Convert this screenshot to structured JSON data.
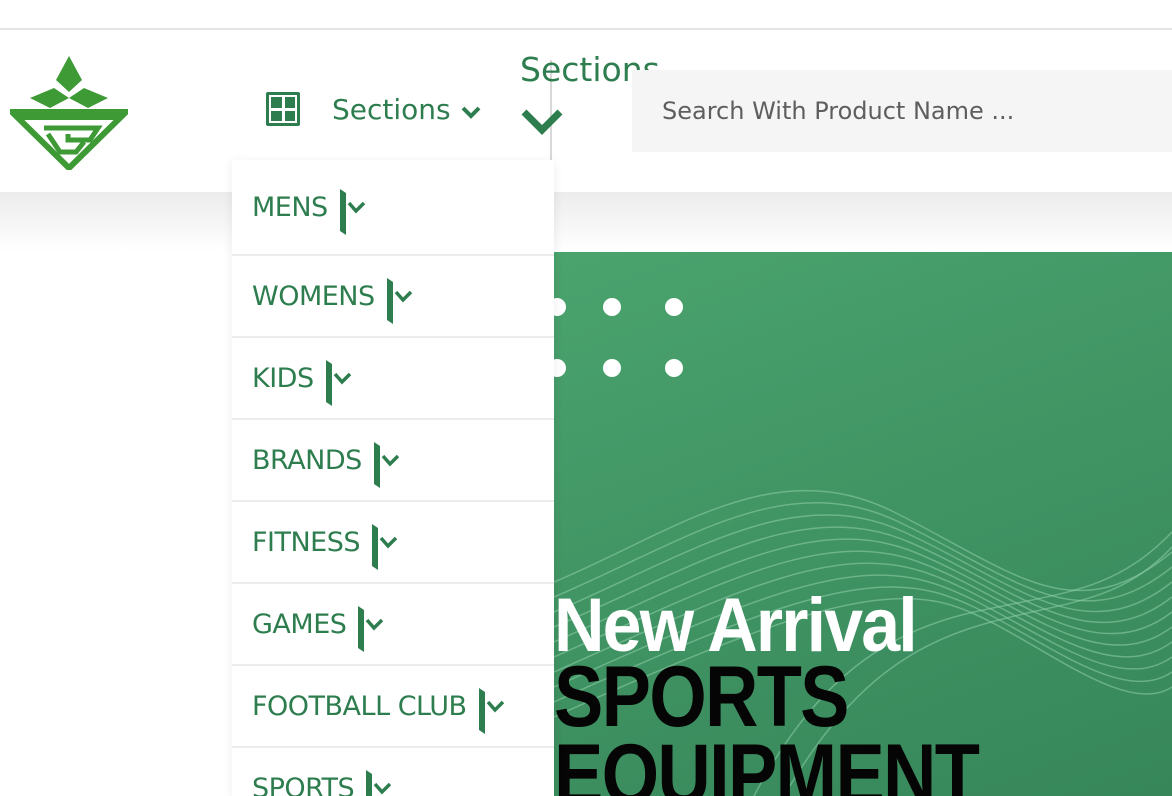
{
  "header": {
    "logo_name": "G diamond logo",
    "sections_label": "Sections",
    "sections_label_large": "Sections",
    "search_placeholder": "Search With Product Name ..."
  },
  "menu": {
    "items": [
      {
        "label": "MENS"
      },
      {
        "label": "WOMENS"
      },
      {
        "label": "KIDS"
      },
      {
        "label": "BRANDS"
      },
      {
        "label": "FITNESS"
      },
      {
        "label": "GAMES"
      },
      {
        "label": "FOOTBALL CLUB"
      },
      {
        "label": "SPORTS"
      }
    ]
  },
  "hero": {
    "line1": "New Arrival",
    "line2": "SPORTS",
    "line3": "EQUIPMENT"
  },
  "colors": {
    "brand_green": "#2e7d4f",
    "hero_green": "#4aa36d",
    "search_bg": "#f5f5f5"
  },
  "icons": [
    "grid-icon",
    "chevron-down-icon",
    "caret-down-icon",
    "logo-icon"
  ]
}
